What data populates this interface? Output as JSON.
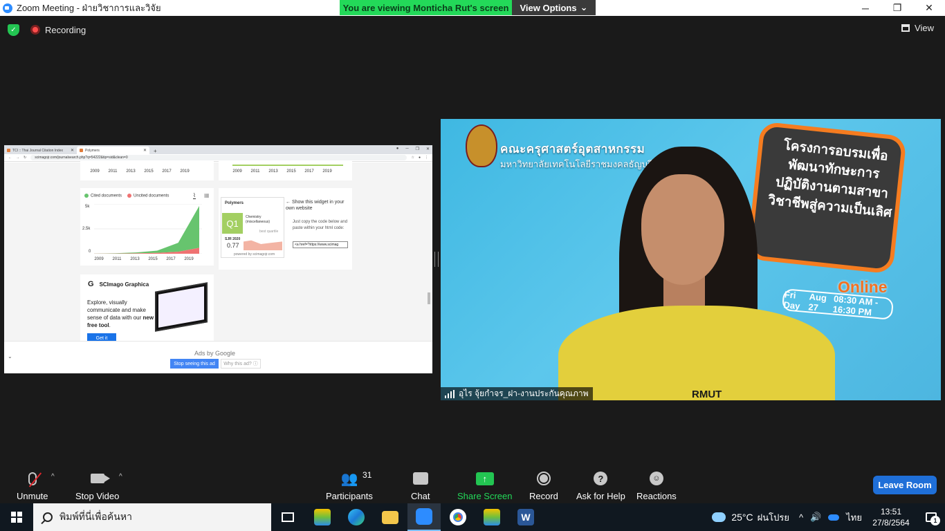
{
  "window": {
    "title": "Zoom Meeting - ฝ่ายวิชาการและวิจัย",
    "minimize": "─",
    "restore": "❐",
    "close": "✕"
  },
  "banner": {
    "viewing": "You are viewing Monticha Rut's screen",
    "view_options": "View Options",
    "chevron": "⌄"
  },
  "meeting": {
    "recording": "Recording",
    "view": "View"
  },
  "shared": {
    "tabs": [
      {
        "label": "TCI :: Thai Journal Citation Index"
      },
      {
        "label": "Polymers"
      }
    ],
    "new_tab": "+",
    "address": "scimagojr.com/journalsearch.php?q=54222&tip=sid&clean=0",
    "years": [
      "2009",
      "2011",
      "2013",
      "2015",
      "2017",
      "2019"
    ],
    "legend": {
      "cited": "Cited documents",
      "uncited": "Uncited documents"
    },
    "y_ticks": [
      "5k",
      "2.5k",
      "0"
    ],
    "widget": {
      "journal": "Polymers",
      "quartile": "Q1",
      "category": "Chemistry (miscellaneous)",
      "best_quartile": "best quartile",
      "sjr_label": "SJR 2020",
      "sjr_value": "0.77",
      "powered": "powered by scimagojr.com",
      "show_title": "← Show this widget in your own website",
      "instructions": "Just copy the code below and paste within your html code:",
      "code": "<a href=\"https://www.scimag"
    },
    "graphica": {
      "logo": "G",
      "title": "SCImago Graphica",
      "text_pre": "Explore, visually communicate and make sense of data with our ",
      "text_bold": "new free tool",
      "text_post": ".",
      "button": "Get it"
    },
    "ads": {
      "by": "Ads by Google",
      "stop": "Stop seeing this ad",
      "why": "Why this ad? ⓘ"
    },
    "collapse": "⌄"
  },
  "video": {
    "faculty": "คณะครุศาสตร์อุตสาหกรรม",
    "university": "มหาวิทยาลัยเทคโนโลยีราชมงคลธัญบุรี",
    "board_text": "โครงการอบรมเพื่อพัฒนาทักษะการปฏิบัติงานตามสาขาวิชาชีพสู่ความเป็นเลิศ",
    "online": "Online",
    "day_label": "Fri Day",
    "date": "Aug 27",
    "time": "08:30 AM - 16:30 PM",
    "shirt": "RMUT",
    "name": "อุไร จุ้ยกำจร_ฝา-งานประกันคุณภาพ"
  },
  "toolbar": {
    "unmute": "Unmute",
    "stop_video": "Stop Video",
    "participants": "Participants",
    "participants_count": "31",
    "chat": "Chat",
    "share_screen": "Share Screen",
    "share_arrow": "↑",
    "record": "Record",
    "help": "Ask for Help",
    "help_glyph": "?",
    "reactions": "Reactions",
    "reactions_glyph": "☺",
    "leave": "Leave Room",
    "caret": "^"
  },
  "taskbar": {
    "search_placeholder": "พิมพ์ที่นี่เพื่อค้นหา",
    "weather_temp": "25°C",
    "weather_text": "ฝนโปรย",
    "language": "ไทย",
    "time": "13:51",
    "date": "27/8/2564",
    "notifications": "1",
    "tray_up": "^"
  },
  "chart_data": {
    "type": "area",
    "x": [
      2009,
      2011,
      2013,
      2015,
      2017,
      2019
    ],
    "series": [
      {
        "name": "Cited documents",
        "values": [
          10,
          40,
          90,
          220,
          900,
          4200
        ]
      },
      {
        "name": "Uncited documents",
        "values": [
          5,
          15,
          40,
          90,
          200,
          600
        ]
      }
    ],
    "ylim": [
      0,
      5000
    ],
    "colors": {
      "cited": "#67c46e",
      "uncited": "#ef7272"
    }
  }
}
